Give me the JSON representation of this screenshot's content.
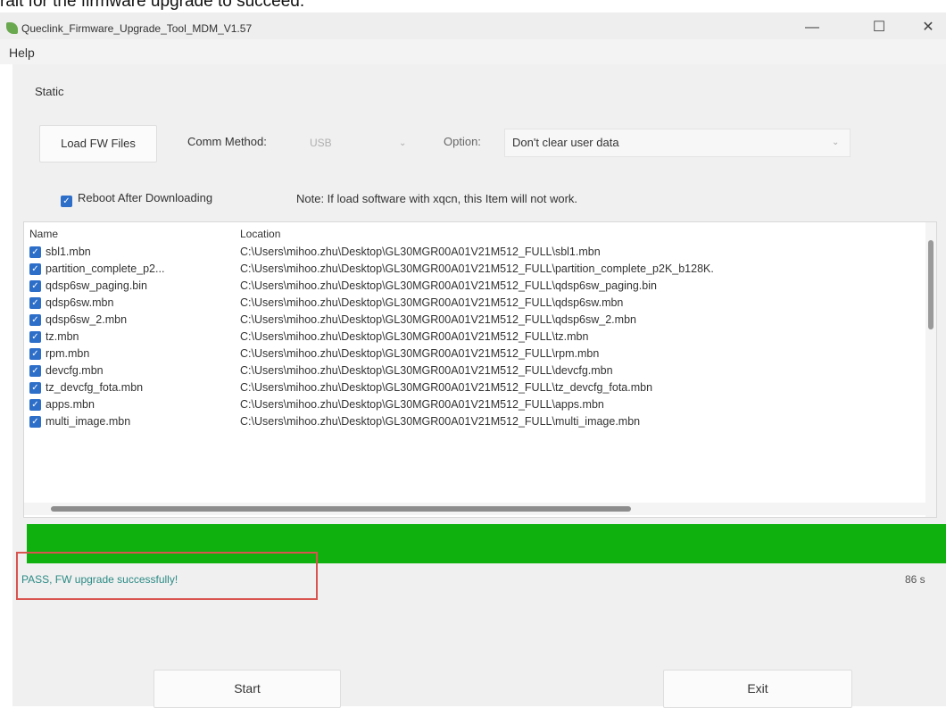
{
  "caption": "rait for the firmware upgrade to succeed.",
  "window": {
    "title": "Queclink_Firmware_Upgrade_Tool_MDM_V1.57",
    "minimize": "—",
    "maximize": "☐",
    "close": "✕"
  },
  "menu": {
    "help": "Help"
  },
  "toolbar": {
    "static_label": "Static",
    "load_fw_label": "Load FW Files",
    "comm_method_label": "Comm Method:",
    "comm_method_value": "USB",
    "option_label": "Option:",
    "option_value": "Don't clear user data",
    "reboot_label": "Reboot After Downloading",
    "reboot_checked": true,
    "note": "Note: If load software with xqcn, this Item will not work."
  },
  "file_list": {
    "columns": [
      "Name",
      "Location"
    ],
    "rows": [
      {
        "name": "sbl1.mbn",
        "location": "C:\\Users\\mihoo.zhu\\Desktop\\GL30MGR00A01V21M512_FULL\\sbl1.mbn",
        "checked": true
      },
      {
        "name": "partition_complete_p2...",
        "location": "C:\\Users\\mihoo.zhu\\Desktop\\GL30MGR00A01V21M512_FULL\\partition_complete_p2K_b128K.",
        "checked": true
      },
      {
        "name": "qdsp6sw_paging.bin",
        "location": "C:\\Users\\mihoo.zhu\\Desktop\\GL30MGR00A01V21M512_FULL\\qdsp6sw_paging.bin",
        "checked": true
      },
      {
        "name": "qdsp6sw.mbn",
        "location": "C:\\Users\\mihoo.zhu\\Desktop\\GL30MGR00A01V21M512_FULL\\qdsp6sw.mbn",
        "checked": true
      },
      {
        "name": "qdsp6sw_2.mbn",
        "location": "C:\\Users\\mihoo.zhu\\Desktop\\GL30MGR00A01V21M512_FULL\\qdsp6sw_2.mbn",
        "checked": true
      },
      {
        "name": "tz.mbn",
        "location": "C:\\Users\\mihoo.zhu\\Desktop\\GL30MGR00A01V21M512_FULL\\tz.mbn",
        "checked": true
      },
      {
        "name": "rpm.mbn",
        "location": "C:\\Users\\mihoo.zhu\\Desktop\\GL30MGR00A01V21M512_FULL\\rpm.mbn",
        "checked": true
      },
      {
        "name": "devcfg.mbn",
        "location": "C:\\Users\\mihoo.zhu\\Desktop\\GL30MGR00A01V21M512_FULL\\devcfg.mbn",
        "checked": true
      },
      {
        "name": "tz_devcfg_fota.mbn",
        "location": "C:\\Users\\mihoo.zhu\\Desktop\\GL30MGR00A01V21M512_FULL\\tz_devcfg_fota.mbn",
        "checked": true
      },
      {
        "name": "apps.mbn",
        "location": "C:\\Users\\mihoo.zhu\\Desktop\\GL30MGR00A01V21M512_FULL\\apps.mbn",
        "checked": true
      },
      {
        "name": "multi_image.mbn",
        "location": "C:\\Users\\mihoo.zhu\\Desktop\\GL30MGR00A01V21M512_FULL\\multi_image.mbn",
        "checked": true
      }
    ]
  },
  "progress": {
    "percent": 100,
    "color": "#0fb10f"
  },
  "status": {
    "message": "PASS, FW upgrade successfully!",
    "elapsed": "86 s",
    "message_color": "#2a8a84",
    "highlight_color": "#d9534f"
  },
  "actions": {
    "start_label": "Start",
    "exit_label": "Exit"
  }
}
